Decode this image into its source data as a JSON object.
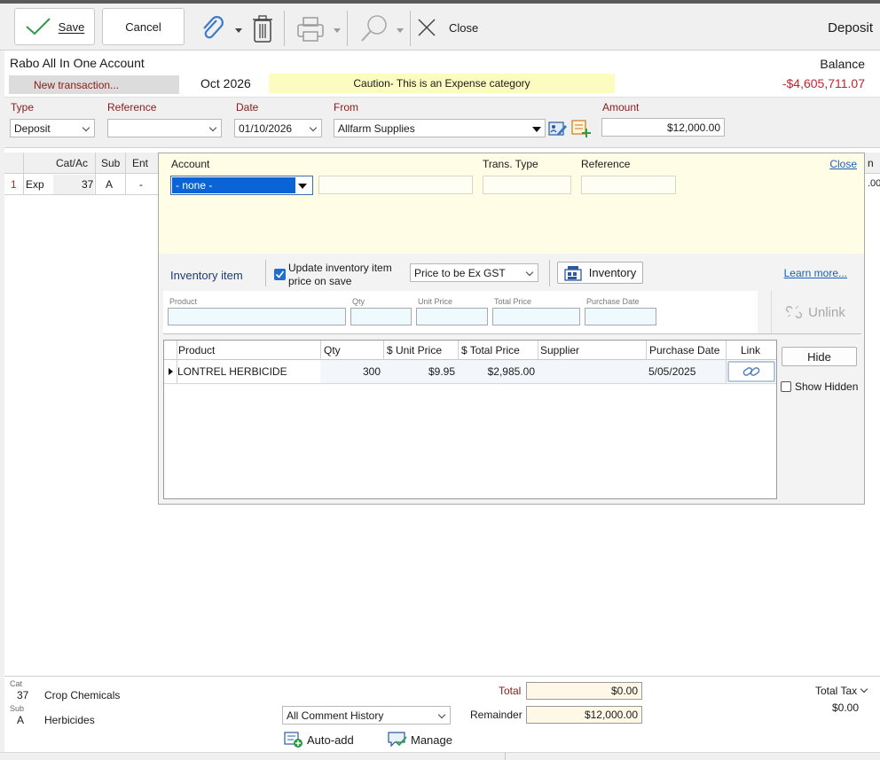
{
  "toolbar": {
    "save_label": "Save",
    "cancel_label": "Cancel",
    "close_label": "Close",
    "mode_label": "Deposit"
  },
  "account": {
    "name": "Rabo All In One Account",
    "status": "New transaction...",
    "period": "Oct 2026",
    "caution": "Caution- This is an Expense category",
    "balance_label": "Balance",
    "balance_value": "-$4,605,711.07"
  },
  "form": {
    "type_label": "Type",
    "type_value": "Deposit",
    "reference_label": "Reference",
    "reference_value": "",
    "date_label": "Date",
    "date_value": "01/10/2026",
    "from_label": "From",
    "from_value": "Allfarm Supplies",
    "amount_label": "Amount",
    "amount_value": "$12,000.00"
  },
  "grid": {
    "headers": [
      "Cat/Ac",
      "Sub",
      "Ent"
    ],
    "row": {
      "num": "1",
      "kind": "Exp",
      "cat": "37",
      "sub": "A",
      "ent": "-"
    },
    "right_header": "n",
    "right_value": ".00"
  },
  "panel": {
    "account_label": "Account",
    "account_value": "- none -",
    "trans_type_label": "Trans. Type",
    "reference_label": "Reference",
    "close_link": "Close",
    "inventory_item_label": "Inventory item",
    "update_label_line1": "Update inventory item",
    "update_label_line2": "price on save",
    "price_select": "Price to be Ex GST",
    "inventory_button": "Inventory",
    "learn_more": "Learn more...",
    "inputs": {
      "product": "Product",
      "qty": "Qty",
      "unit_price": "Unit Price",
      "total_price": "Total Price",
      "purchase_date": "Purchase Date"
    },
    "unlink_button": "Unlink",
    "hide_button": "Hide",
    "show_hidden_label": "Show Hidden",
    "table": {
      "columns": [
        "Product",
        "Qty",
        "$ Unit Price",
        "$ Total Price",
        "Supplier",
        "Purchase Date",
        "Link"
      ],
      "rows": [
        {
          "product": "LONTREL HERBICIDE",
          "qty": "300",
          "unit_price": "$9.95",
          "total_price": "$2,985.00",
          "supplier": "",
          "purchase_date": "5/05/2025"
        }
      ]
    }
  },
  "footer": {
    "cat_small": "Cat",
    "cat_code": "37",
    "cat_name": "Crop Chemicals",
    "sub_small": "Sub",
    "sub_code": "A",
    "sub_name": "Herbicides",
    "comment_select": "All Comment History",
    "auto_add": "Auto-add",
    "manage": "Manage",
    "total_label": "Total",
    "total_value": "$0.00",
    "remainder_label": "Remainder",
    "remainder_value": "$12,000.00",
    "total_tax_label": "Total Tax",
    "total_tax_value": "$0.00"
  },
  "colors": {
    "accent_red": "#8b1a1a",
    "balance_red": "#c0262d",
    "caution_bg": "#fcfcc0",
    "panel_yellow": "#fffde6",
    "selection_blue": "#0a64d6",
    "link_blue": "#1a5fb4"
  }
}
